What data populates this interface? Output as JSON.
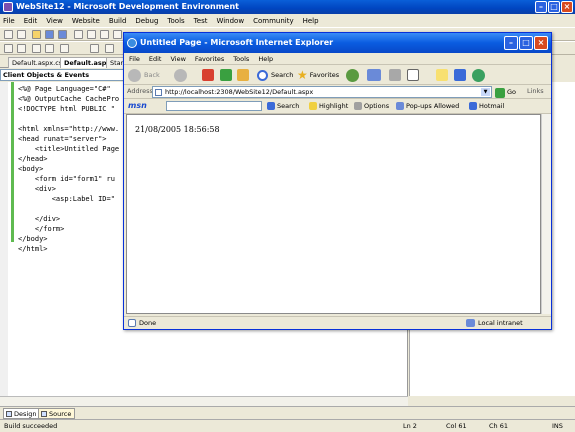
{
  "vs": {
    "title": "WebSite12 - Microsoft Development Environment",
    "menu": [
      "File",
      "Edit",
      "View",
      "Website",
      "Build",
      "Debug",
      "Tools",
      "Test",
      "Window",
      "Community",
      "Help"
    ],
    "tabs": [
      "Default.aspx.cs",
      "Default.aspx",
      "Start"
    ],
    "object_bar": "Client Objects & Events",
    "code_lines": [
      "<%@ Page Language=\"C#\"",
      "<%@ OutputCache CachePro",
      "<!DOCTYPE html PUBLIC \"",
      "",
      "<html xmlns=\"http://www.",
      "<head runat=\"server\">",
      "    <title>Untitled Page",
      "</head>",
      "<body>",
      "    <form id=\"form1\" ru",
      "    <div>",
      "        <asp:Label ID=\"",
      "",
      "    </div>",
      "    </form>",
      "</body>",
      "</html>"
    ],
    "design_button": "Design",
    "source_button": "Source",
    "status": {
      "message": "Build succeeded",
      "ln": "Ln 2",
      "col": "Col 61",
      "ch": "Ch 61",
      "ins": "INS"
    }
  },
  "ie": {
    "title": "Untitled Page - Microsoft Internet Explorer",
    "menu": [
      "File",
      "Edit",
      "View",
      "Favorites",
      "Tools",
      "Help"
    ],
    "toolbar": {
      "back": "Back",
      "search": "Search",
      "favorites": "Favorites"
    },
    "address_label": "Address",
    "address": "http://localhost:2308/WebSite12/Default.aspx",
    "go": "Go",
    "links": "Links",
    "msn": {
      "logo": "msn",
      "search": "Search",
      "highlight": "Highlight",
      "options": "Options",
      "popups": "Pop-ups Allowed",
      "hotmail": "Hotmail"
    },
    "page_text": "21/08/2005 18:56:58",
    "status_left": "Done",
    "status_zone": "Local intranet"
  },
  "colors": {
    "title_blue": "#0a5fd8",
    "close_red": "#d84a20"
  }
}
